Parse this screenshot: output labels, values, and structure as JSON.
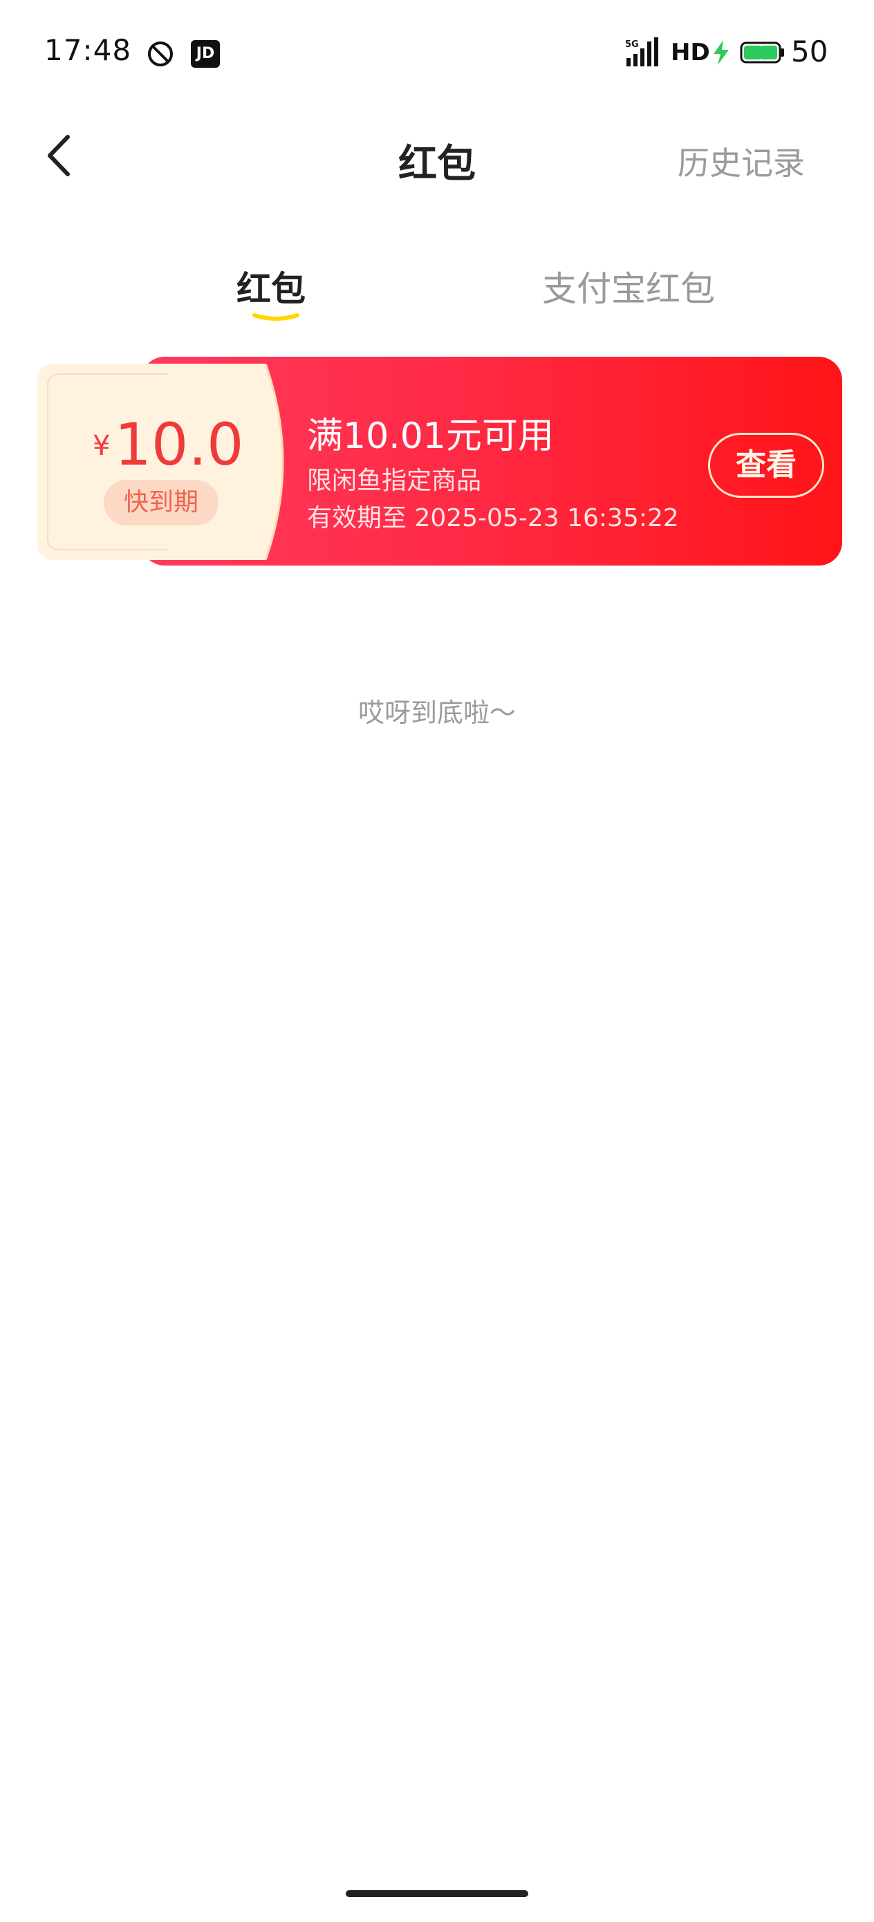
{
  "status_bar": {
    "time": "17:48",
    "jd_icon_text": "JD",
    "network": "5G",
    "hd_label": "HD",
    "battery_level": "50",
    "icons": [
      "do-not-disturb-icon",
      "jd-app-icon",
      "signal-icon",
      "charging-bolt-icon",
      "battery-icon"
    ]
  },
  "header": {
    "title": "红包",
    "history_label": "历史记录",
    "back_icon": "chevron-left-icon"
  },
  "tabs": [
    {
      "label": "红包",
      "active": true
    },
    {
      "label": "支付宝红包",
      "active": false
    }
  ],
  "coupon": {
    "currency": "¥",
    "amount": "10.0",
    "badge": "快到期",
    "title": "满10.01元可用",
    "scope": "限闲鱼指定商品",
    "validity": "有效期至 2025-05-23 16:35:22",
    "action_label": "查看"
  },
  "list_end_text": "哎呀到底啦～",
  "colors": {
    "accent_red": "#ff2a45",
    "tab_indicator": "#ffd600",
    "coupon_stub": "#fff3df"
  }
}
